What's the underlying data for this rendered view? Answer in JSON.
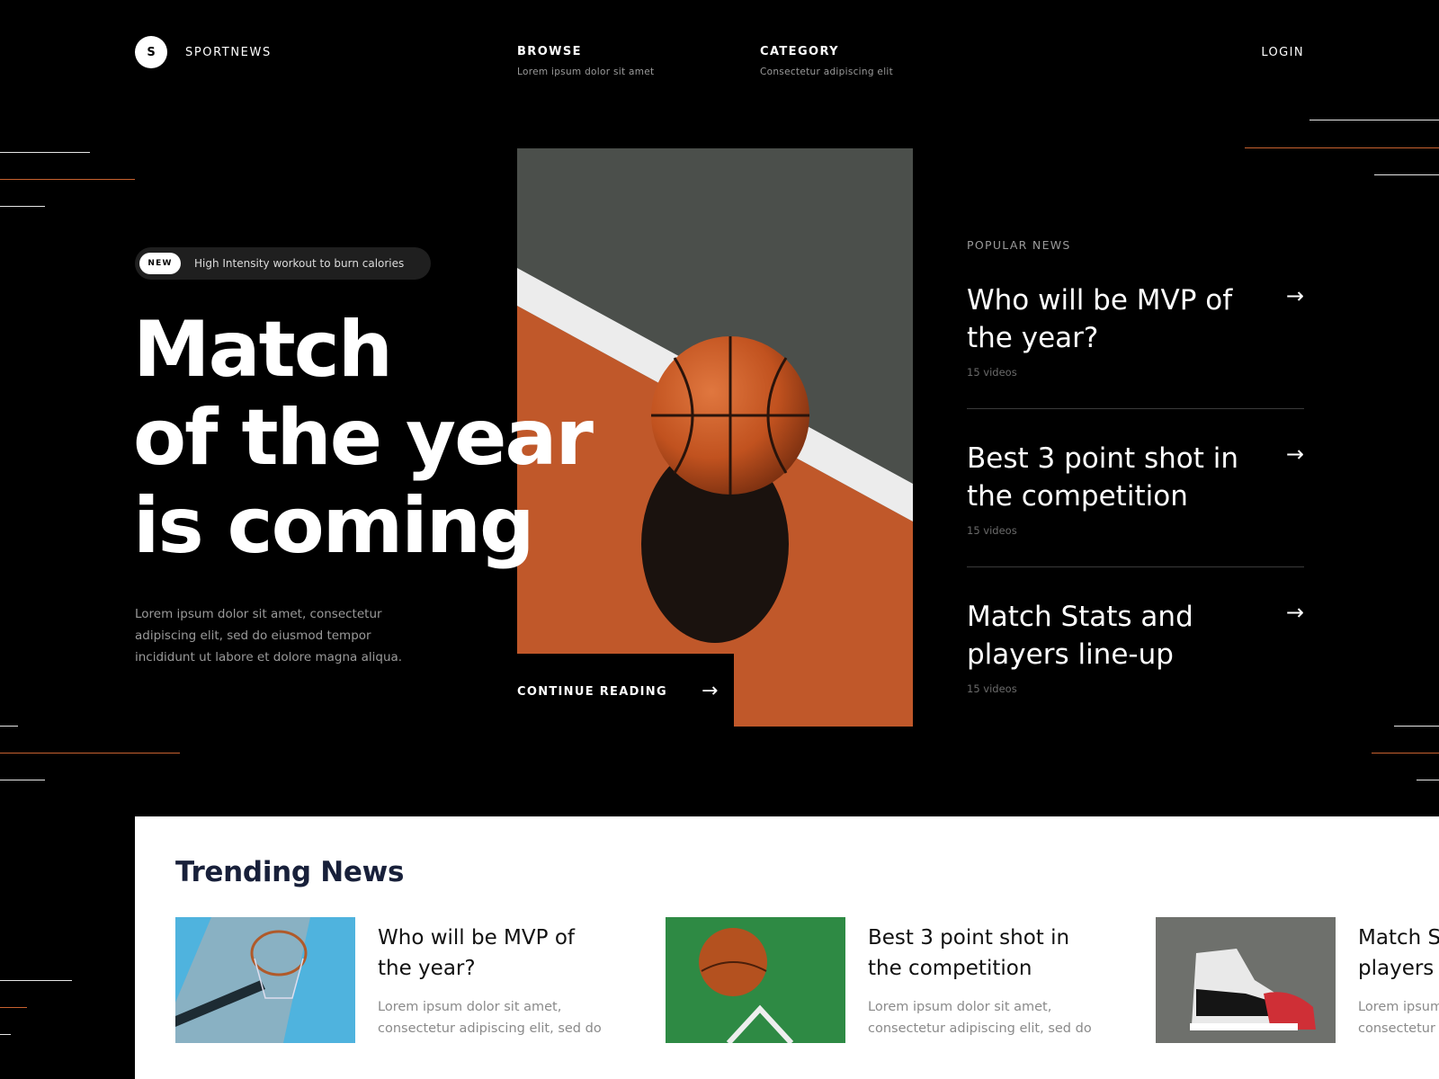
{
  "header": {
    "logo_letter": "S",
    "brand": "SPORTNEWS",
    "nav": [
      {
        "title": "BROWSE",
        "subtitle": "Lorem ipsum dolor sit amet"
      },
      {
        "title": "CATEGORY",
        "subtitle": "Consectetur adipiscing elit"
      }
    ],
    "login": "LOGIN"
  },
  "hero": {
    "badge_tag": "NEW",
    "badge_text": "High Intensity workout to burn calories",
    "title_lines": [
      "Match",
      "of the year",
      "is coming"
    ],
    "description": "Lorem ipsum dolor sit amet, consectetur adipiscing elit, sed do eiusmod tempor incididunt ut labore et dolore magna aliqua.",
    "cta": "CONTINUE READING"
  },
  "popular": {
    "heading": "POPULAR NEWS",
    "items": [
      {
        "title": "Who will be MVP of the year?",
        "meta": "15 videos"
      },
      {
        "title": "Best 3 point shot in the competition",
        "meta": "15 videos"
      },
      {
        "title": "Match Stats and players line-up",
        "meta": "15 videos"
      }
    ]
  },
  "trending": {
    "heading": "Trending News",
    "cards": [
      {
        "title_lines": [
          "Who will be MVP of",
          "the year?"
        ],
        "desc_lines": [
          "Lorem ipsum dolor sit amet,",
          "consectetur adipiscing elit, sed do"
        ]
      },
      {
        "title_lines": [
          "Best 3 point shot in",
          "the competition"
        ],
        "desc_lines": [
          "Lorem ipsum dolor sit amet,",
          "consectetur adipiscing elit, sed do"
        ]
      },
      {
        "title_lines": [
          "Match Stats and",
          "players line-up"
        ],
        "desc_lines": [
          "Lorem ipsum dolor sit amet,",
          "consectetur adipiscing elit, sed do"
        ]
      }
    ]
  },
  "colors": {
    "background": "#000000",
    "accent_orange": "#c8612f",
    "court_orange": "#c0582a",
    "court_gray": "#4b4f4b",
    "trending_heading": "#18203a"
  },
  "icons": [
    "right-arrow-icon",
    "basketball-image",
    "hoop-image",
    "ball-on-grass-image",
    "sneaker-image"
  ]
}
